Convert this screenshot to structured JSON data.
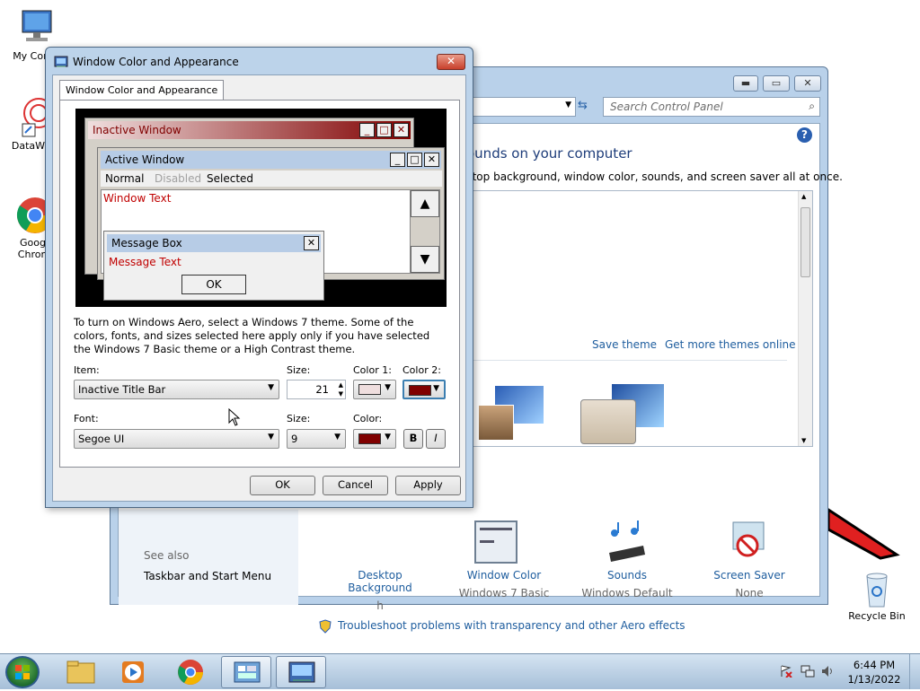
{
  "desktop": {
    "icons": [
      {
        "label": "My Comp"
      },
      {
        "label": "DataWag"
      },
      {
        "label": "Googl Chrom"
      },
      {
        "label": "Recycle Bin"
      }
    ]
  },
  "control_panel": {
    "search_placeholder": "Search Control Panel",
    "heading": "ounds on your computer",
    "subheading": "ctop background, window color, sounds, and screen saver all at once.",
    "save_theme": "Save theme",
    "get_more_themes": "Get more themes online",
    "bottom_items": [
      {
        "title": "Desktop Background",
        "subtitle": "h"
      },
      {
        "title": "Window Color",
        "subtitle": "Windows 7 Basic"
      },
      {
        "title": "Sounds",
        "subtitle": "Windows Default"
      },
      {
        "title": "Screen Saver",
        "subtitle": "None"
      }
    ],
    "see_also": "See also",
    "taskbar_link": "Taskbar and Start Menu",
    "troubleshoot": "Troubleshoot problems with transparency and other Aero effects"
  },
  "dialog": {
    "title": "Window Color and Appearance",
    "tab": "Window Color and Appearance",
    "preview": {
      "inactive_window": "Inactive Window",
      "active_window": "Active Window",
      "menu_normal": "Normal",
      "menu_disabled": "Disabled",
      "menu_selected": "Selected",
      "window_text": "Window Text",
      "message_box": "Message Box",
      "message_text": "Message Text",
      "ok": "OK"
    },
    "description": "To turn on Windows Aero, select a Windows 7 theme.  Some of the colors, fonts, and sizes selected here apply only if you have selected the Windows 7 Basic theme or a High Contrast theme.",
    "item_label": "Item:",
    "item_value": "Inactive Title Bar",
    "size_label": "Size:",
    "size_value": "21",
    "color1_label": "Color 1:",
    "color2_label": "Color 2:",
    "font_label": "Font:",
    "font_value": "Segoe UI",
    "font_size_label": "Size:",
    "font_size_value": "9",
    "font_color_label": "Color:",
    "bold_label": "B",
    "italic_label": "I",
    "ok_button": "OK",
    "cancel_button": "Cancel",
    "apply_button": "Apply",
    "colors": {
      "color1": "#efdede",
      "color2": "#800000",
      "font_color": "#800000"
    }
  },
  "taskbar": {
    "time": "6:44 PM",
    "date": "1/13/2022"
  }
}
